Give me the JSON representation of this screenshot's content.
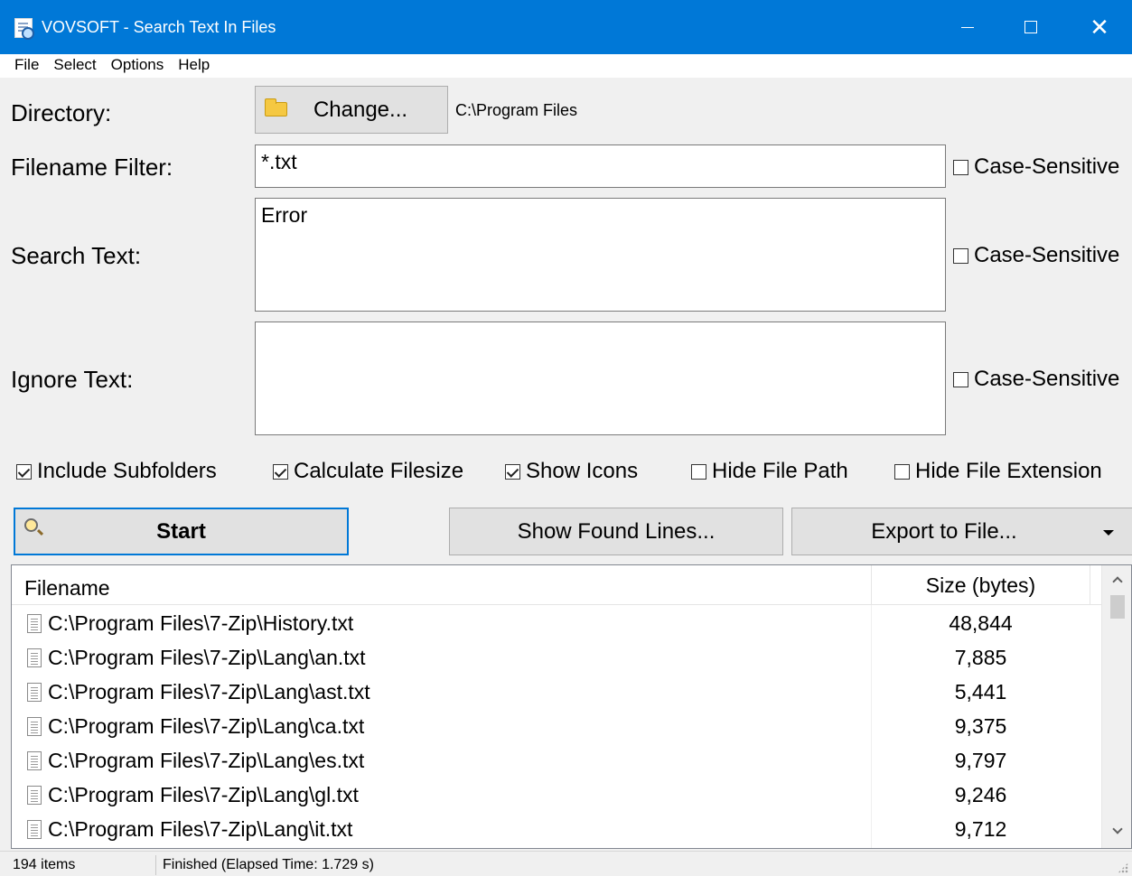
{
  "window": {
    "title": "VOVSOFT - Search Text In Files",
    "min_glyph": "",
    "close_glyph": "✕"
  },
  "menu": [
    "File",
    "Select",
    "Options",
    "Help"
  ],
  "directory": {
    "label": "Directory:",
    "button_label": "Change...",
    "value": "C:\\Program Files"
  },
  "filename_filter": {
    "label": "Filename Filter:",
    "value": "*.txt",
    "case_label": "Case-Sensitive"
  },
  "search_text": {
    "label": "Search Text:",
    "value": "Error",
    "case_label": "Case-Sensitive"
  },
  "ignore_text": {
    "label": "Ignore Text:",
    "value": "",
    "case_label": "Case-Sensitive"
  },
  "options": [
    {
      "label": "Include Subfolders",
      "checked": true
    },
    {
      "label": "Calculate Filesize",
      "checked": true
    },
    {
      "label": "Show Icons",
      "checked": true
    },
    {
      "label": "Hide File Path",
      "checked": false
    },
    {
      "label": "Hide File Extension",
      "checked": false
    }
  ],
  "buttons": {
    "start": "Start",
    "show_found": "Show Found Lines...",
    "export": "Export to File..."
  },
  "results": {
    "columns": [
      "Filename",
      "Size (bytes)"
    ],
    "rows": [
      {
        "path": "C:\\Program Files\\7-Zip\\History.txt",
        "size": "48,844"
      },
      {
        "path": "C:\\Program Files\\7-Zip\\Lang\\an.txt",
        "size": "7,885"
      },
      {
        "path": "C:\\Program Files\\7-Zip\\Lang\\ast.txt",
        "size": "5,441"
      },
      {
        "path": "C:\\Program Files\\7-Zip\\Lang\\ca.txt",
        "size": "9,375"
      },
      {
        "path": "C:\\Program Files\\7-Zip\\Lang\\es.txt",
        "size": "9,797"
      },
      {
        "path": "C:\\Program Files\\7-Zip\\Lang\\gl.txt",
        "size": "9,246"
      },
      {
        "path": "C:\\Program Files\\7-Zip\\Lang\\it.txt",
        "size": "9,712"
      }
    ]
  },
  "status": {
    "count": "194 items",
    "message": "Finished (Elapsed Time: 1.729 s)"
  },
  "icons": {
    "app": "search-document-icon",
    "folder": "folder-icon",
    "start": "magnifier-icon",
    "file": "text-file-icon"
  },
  "colors": {
    "titlebar": "#0078d7",
    "focus_border": "#0078d7"
  }
}
